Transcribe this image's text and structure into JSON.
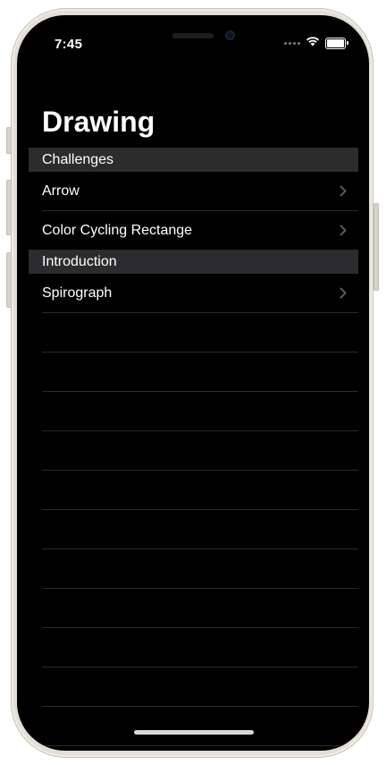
{
  "status_bar": {
    "time": "7:45",
    "icons": [
      "cellular-signal-icon",
      "wifi-icon",
      "battery-icon"
    ],
    "battery_level": 1.0
  },
  "navigation": {
    "title": "Drawing"
  },
  "sections": [
    {
      "header": "Challenges",
      "rows": [
        {
          "label": "Arrow",
          "icon": "chevron-right-icon"
        },
        {
          "label": "Color Cycling Rectange",
          "icon": "chevron-right-icon"
        }
      ]
    },
    {
      "header": "Introduction",
      "rows": [
        {
          "label": "Spirograph",
          "icon": "chevron-right-icon"
        }
      ]
    }
  ],
  "colors": {
    "background": "#000000",
    "section_header_bg": "#2c2c2e",
    "separator": "#2a2a2c",
    "chevron": "#5a5a5e",
    "text": "#ffffff"
  }
}
